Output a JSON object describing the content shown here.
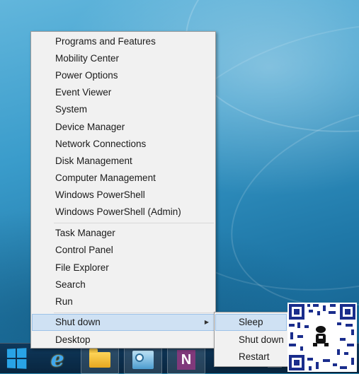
{
  "menu": {
    "groups": [
      [
        "Programs and Features",
        "Mobility Center",
        "Power Options",
        "Event Viewer",
        "System",
        "Device Manager",
        "Network Connections",
        "Disk Management",
        "Computer Management",
        "Windows PowerShell",
        "Windows PowerShell (Admin)"
      ],
      [
        "Task Manager",
        "Control Panel",
        "File Explorer",
        "Search",
        "Run"
      ],
      [
        "Shut down",
        "Desktop"
      ]
    ],
    "highlighted": "Shut down"
  },
  "submenu": {
    "items": [
      "Sleep",
      "Shut down",
      "Restart"
    ],
    "highlighted": "Sleep"
  },
  "taskbar": {
    "apps": [
      "start",
      "internet-explorer",
      "file-explorer",
      "control-panel",
      "onenote",
      "partial-app"
    ],
    "onenote_letter": "N"
  },
  "colors": {
    "menu_bg": "#f1f1f1",
    "highlight_bg": "#cfe1f3",
    "highlight_border": "#9cc2e8",
    "windows_blue": "#29a3e6",
    "onenote_purple": "#80397b"
  }
}
